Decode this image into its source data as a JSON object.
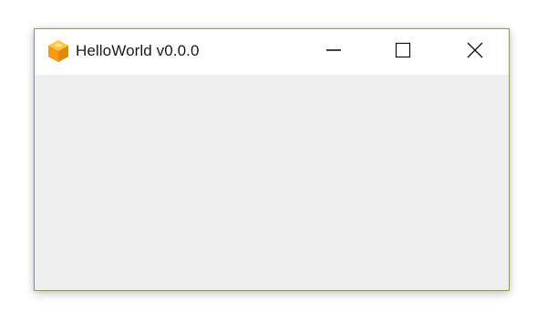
{
  "window": {
    "title": "HelloWorld v0.0.0",
    "app_icon": "orange-hexagon-cube-icon",
    "controls": {
      "minimize": "minimize-icon",
      "maximize": "maximize-icon",
      "close": "close-icon"
    },
    "colors": {
      "border": "#7ea35c",
      "titlebar_bg": "#ffffff",
      "client_bg": "#efefef",
      "icon_orange": "#f2a01f"
    }
  }
}
